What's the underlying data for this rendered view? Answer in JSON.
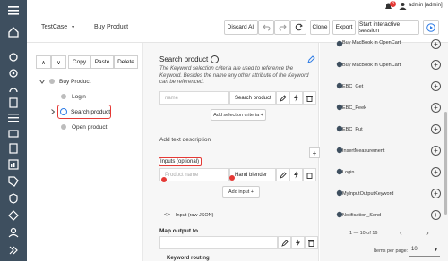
{
  "topbar": {
    "user": "admin [admin]",
    "notif_count": "3"
  },
  "header": {
    "breadcrumb": "TestCase",
    "case_name": "Buy Product",
    "discard_all": "Discard All",
    "clone": "Clone",
    "export": "Export",
    "start_session": "Start interactive session"
  },
  "left": {
    "up": "∧",
    "down": "∨",
    "copy": "Copy",
    "paste": "Paste",
    "delete": "Delete",
    "tree_root": "Buy Product",
    "items": [
      "Login",
      "Search product",
      "Open product"
    ]
  },
  "middle": {
    "title": "Search product",
    "description": "The Keyword selection criteria are used to reference the Keyword. Besides the name any other attribute of the Keyword can be referenced.",
    "criteria_name_placeholder": "name",
    "criteria_value": "Search product",
    "add_criteria": "Add selection criteria +",
    "add_text_description": "Add text description",
    "inputs_label": "Inputs (optional)",
    "input_name_placeholder": "Product name",
    "input_value": "Hand blender",
    "add_input": "Add input +",
    "input_raw": "Input (raw JSON)",
    "map_output": "Map output to",
    "keyword_routing": "Keyword routing"
  },
  "right": {
    "partial_top": "Buy MacBook in OpenCart",
    "keywords": [
      "Buy MacBook in OpenCart",
      "EBC_Get",
      "EBC_Peek",
      "EBC_Put",
      "InsertMeasurement",
      "Login",
      "MyInputOutputKeyword",
      "Notification_Send"
    ],
    "pagination": "1 — 10 of 16",
    "items_per_page_label": "Items per page:",
    "items_per_page": "10"
  },
  "colors": {
    "sidebar": "#3e4f5f",
    "accent": "#2d7be5",
    "highlight": "#e53935"
  }
}
